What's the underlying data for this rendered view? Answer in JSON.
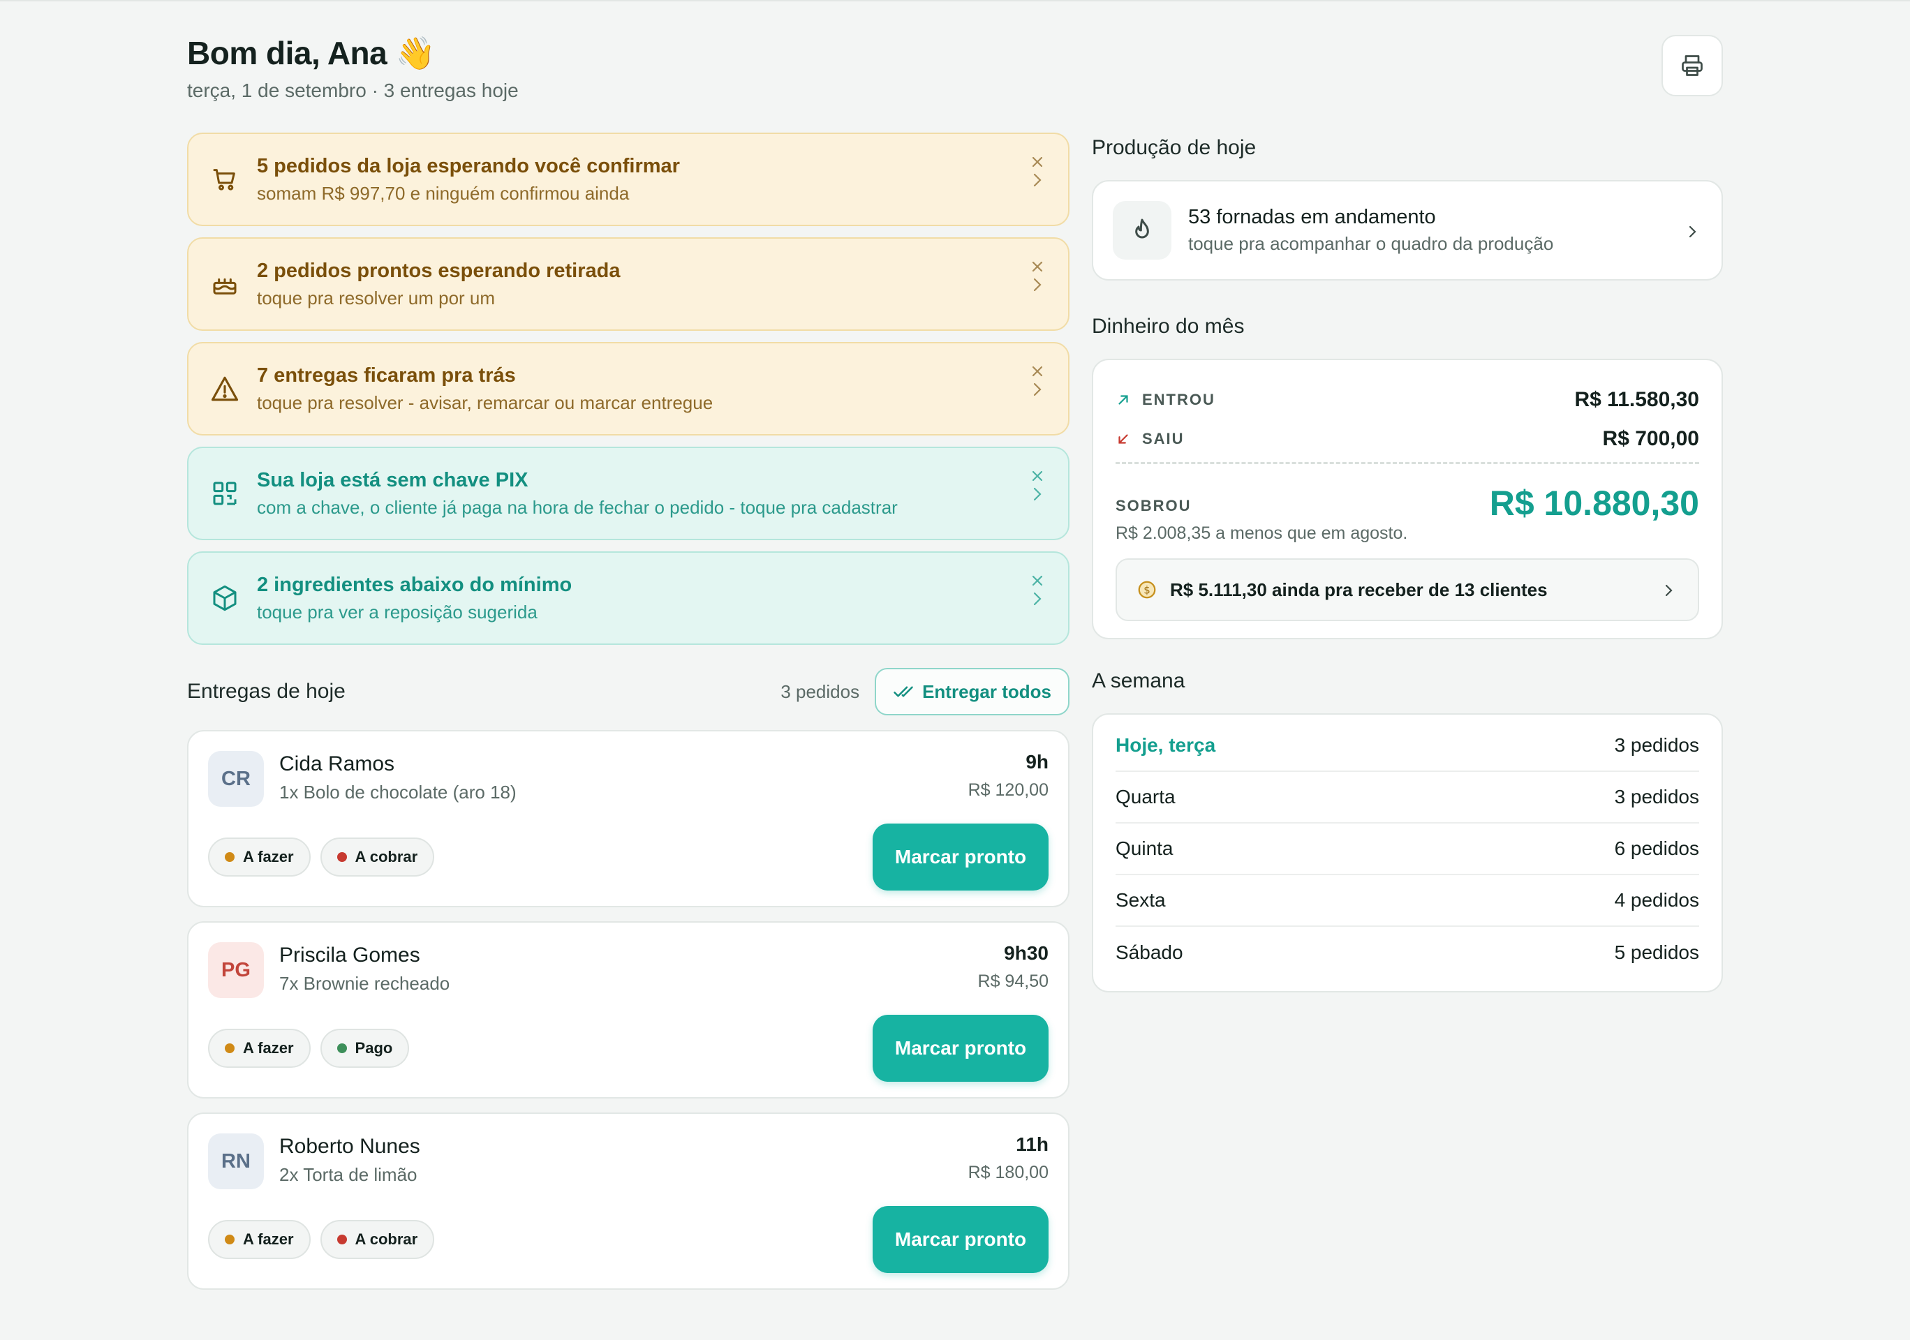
{
  "header": {
    "greeting": "Bom dia, Ana 👋",
    "subtitle": "terça, 1 de setembro · 3 entregas hoje"
  },
  "alerts": [
    {
      "icon": "cart-icon",
      "title": "5 pedidos da loja esperando você confirmar",
      "subtitle": "somam R$ 997,70 e ninguém confirmou ainda"
    },
    {
      "icon": "cake-icon",
      "title": "2 pedidos prontos esperando retirada",
      "subtitle": "toque pra resolver um por um"
    },
    {
      "icon": "warning-icon",
      "title": "7 entregas ficaram pra trás",
      "subtitle": "toque pra resolver - avisar, remarcar ou marcar entregue"
    },
    {
      "icon": "qr-code-icon",
      "title": "Sua loja está sem chave PIX",
      "subtitle": "com a chave, o cliente já paga na hora de fechar o pedido - toque pra cadastrar"
    },
    {
      "icon": "box-icon",
      "title": "2 ingredientes abaixo do mínimo",
      "subtitle": "toque pra ver a reposição sugerida"
    }
  ],
  "deliveries": {
    "title": "Entregas de hoje",
    "count": "3 pedidos",
    "deliver_all_label": "Entregar todos",
    "orders": [
      {
        "initials": "CR",
        "name": "Cida Ramos",
        "item": "1x Bolo de chocolate (aro 18)",
        "time": "9h",
        "price": "R$ 120,00",
        "status": "A fazer",
        "payment": "A cobrar",
        "button": "Marcar pronto"
      },
      {
        "initials": "PG",
        "name": "Priscila Gomes",
        "item": "7x Brownie recheado",
        "time": "9h30",
        "price": "R$ 94,50",
        "status": "A fazer",
        "payment": "Pago",
        "button": "Marcar pronto"
      },
      {
        "initials": "RN",
        "name": "Roberto Nunes",
        "item": "2x Torta de limão",
        "time": "11h",
        "price": "R$ 180,00",
        "status": "A fazer",
        "payment": "A cobrar",
        "button": "Marcar pronto"
      }
    ]
  },
  "production": {
    "title": "Produção de hoje",
    "headline": "53 fornadas em andamento",
    "subtitle": "toque pra acompanhar o quadro da produção"
  },
  "money": {
    "title": "Dinheiro do mês",
    "in_label": "ENTROU",
    "in_value": "R$ 11.580,30",
    "out_label": "SAIU",
    "out_value": "R$ 700,00",
    "left_label": "SOBROU",
    "left_value": "R$ 10.880,30",
    "left_note": "R$ 2.008,35 a menos que em agosto.",
    "receivable": "R$ 5.111,30 ainda pra receber de 13 clientes"
  },
  "week": {
    "title": "A semana",
    "days": [
      {
        "day": "Hoje, terça",
        "count": "3 pedidos"
      },
      {
        "day": "Quarta",
        "count": "3 pedidos"
      },
      {
        "day": "Quinta",
        "count": "6 pedidos"
      },
      {
        "day": "Sexta",
        "count": "4 pedidos"
      },
      {
        "day": "Sábado",
        "count": "5 pedidos"
      }
    ]
  },
  "colors": {
    "accent": "#17b3a2",
    "warn_bg": "#fcf2dc",
    "info_bg": "#e3f6f2"
  }
}
